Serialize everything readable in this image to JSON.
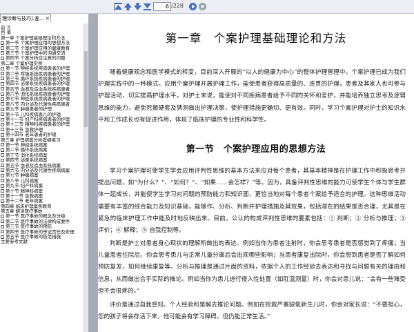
{
  "toolbar": {
    "page_current": "6",
    "page_total": "/228",
    "icons": [
      "toolbar-edge-icon",
      "first-page-icon",
      "prev-page-icon",
      "next-page-icon",
      "last-page-icon",
      "go-icon",
      "stop-icon"
    ]
  },
  "tab": {
    "label": "理诊断与技巧].鉴...",
    "close": "×"
  },
  "sidebar": {
    "items": [
      {
        "label": "前 言",
        "level": 0
      },
      {
        "label": "目 录",
        "level": 0
      },
      {
        "label": "第一章 个案护理基础理论和方法",
        "level": 0
      },
      {
        "label": "第一节 个案护理应用的思想方法",
        "level": 1
      },
      {
        "label": "第二节 个案护理应用的健康教育",
        "level": 1
      },
      {
        "label": "第三节 个案护理中的沟通交流",
        "level": 1
      },
      {
        "label": "第四节 个案分析应注意的问题",
        "level": 1
      },
      {
        "label": "第二章 个案护理实例",
        "level": 0
      },
      {
        "label": "第一节 神经系统疾病患者的护理",
        "level": 1
      },
      {
        "label": "第二节 呼吸系统疾病患者的护理",
        "level": 1
      },
      {
        "label": "第三节 循环系统疾病患者的护理",
        "level": 1
      },
      {
        "label": "第四节 泌尿系统疾病患者的护理",
        "level": 1
      },
      {
        "label": "第五节 血液及造血系统疾病患者",
        "level": 1
      },
      {
        "label": "第六节 消化系统疾病患者的护理",
        "level": 1
      },
      {
        "label": "第七节 神经系统疾病患者的护理",
        "level": 1
      },
      {
        "label": "第八节 内分泌及代谢性疾病患者",
        "level": 1
      },
      {
        "label": "第九节 肿瘤患者的护理",
        "level": 1
      },
      {
        "label": "第十节 儿科疾病患儿的护理",
        "level": 1
      },
      {
        "label": "第十一节 妇产科疾病患者的护理",
        "level": 1
      },
      {
        "label": "第十二节 精神科疾病患者的护理",
        "level": 1
      },
      {
        "label": "第十三节 急救护理",
        "level": 1
      },
      {
        "label": "第十四节 老年患者的护理",
        "level": 1
      },
      {
        "label": "第三章 护理病案分析提纲练习",
        "level": 0
      },
      {
        "label": "第一节 神经系统病案",
        "level": 1
      },
      {
        "label": "第二节 循环系统病案",
        "level": 1
      },
      {
        "label": "第三节 消化系统病案",
        "level": 1
      },
      {
        "label": "第四节 泌尿系统病案",
        "level": 1
      },
      {
        "label": "第五节 血液及造血系统病案",
        "level": 1
      },
      {
        "label": "第六节 内分泌及代谢性疾病病案",
        "level": 1
      },
      {
        "label": "第七节 肿瘤病案",
        "level": 1
      },
      {
        "label": "第八节 儿科病案",
        "level": 1
      },
      {
        "label": "第九节 妇产科病案",
        "level": 1
      },
      {
        "label": "第十节 精神科病案",
        "level": 1
      },
      {
        "label": "第十一节 急救病案",
        "level": 1
      },
      {
        "label": "第十二节 老年病案",
        "level": 1
      },
      {
        "label": "第四章 临床护理案例教育",
        "level": 0
      },
      {
        "label": "第五章 解读医疗事故",
        "level": 0
      },
      {
        "label": "第一节 医疗事故的概念及分级",
        "level": 1
      },
      {
        "label": "第二节 医疗事故的法律构成要件",
        "level": 1
      },
      {
        "label": "第三节 医疗事故的预防",
        "level": 1
      },
      {
        "label": "第四节 医疗事故的举证责任及处理",
        "level": 1
      },
      {
        "label": "第五节 医疗事故的防范措施",
        "level": 1
      },
      {
        "label": "主要参考文献",
        "level": 0
      }
    ]
  },
  "document": {
    "chapter_title": "第一章　个案护理基础理论和方法",
    "para1": "随着健康观念和医学模式的转变，目前深入开展的“以人的健康为中心”的整体护理管理中，个案护理已成为我们护理实践中的一种模式。应用个案护理开展护理工作，能使患者获得高质量的、连贯的护理，患者及其家人也可参与护理活动，切实提高护理水平。对护士来说，能使对不同疾病患者给予不同的关怀和爱护，并能培养独立思考及逻辑思维的能力，避免死搬硬套及猜测做出护理决策，使护理措施更确切、更有效。同时，学习个案护理对护士的知识水平和工作成长也有促进作用，体现了临床护理的专业性和科学性。",
    "section_title": "第一节　个案护理应用的思想方法",
    "para2": "学习个案护理可使学生学会应用评判性思维的基本方法来应对每个患者，其基本精神是在护理工作中积极思考并提出问题，如“为什么？”、“如何？”、“如果……会怎样？”等。因为，具备评判性思维的能力可使学生个体与学生群体一起成长，并能使学生学习对问题的预防能力和知识面，更恰当地对每个患者个案给予适合的护理。这种思维活动需要有丰富的综合能力及知识基础，能够作、分析、判断并护理措施及其效果，包括潜在的结果是否合理，尤其是在紧急的临床护理工作中能及时地反映出来。目前，公认的构成评判性思维的要素包括：① 判断；② 分析与推理；③ 评价；④ 解释；⑤ 自我控制等。",
    "para3": "判断是护士对患者身心现状的理解所做出的表达。例如当你为患者注射时，你会思考患者是否感觉到了疼痛；当儿童患者住院后，你会思考患儿与正常儿童分离后会出现哪些影响；当患者康复出院时，你会想到患者是否了解如何预防复发，如何继续康复等。分析与推理是通过片面的资料，依据个人的工作经验去表达和寻找与问题有关的理由和信息，从而做出合乎实际的推论。例如当你为患儿进行侵入性处置（如肛温测量）时，你会对患儿说：“会有一些难受但不会很疼的。”",
    "para4": "评价是通过自我感知、个人经验和是解去推论问题。例如在抢救严重缺氧新生儿时，你会对家长说：“不要担心，您的孩子将会存活下来，他可能会有学习障碍，但仍能正常生活。”"
  },
  "colors": {
    "toolbar_bg": "#eceef3",
    "icon_blue": "#3f6fc4",
    "gutter": "#a8adb5"
  }
}
